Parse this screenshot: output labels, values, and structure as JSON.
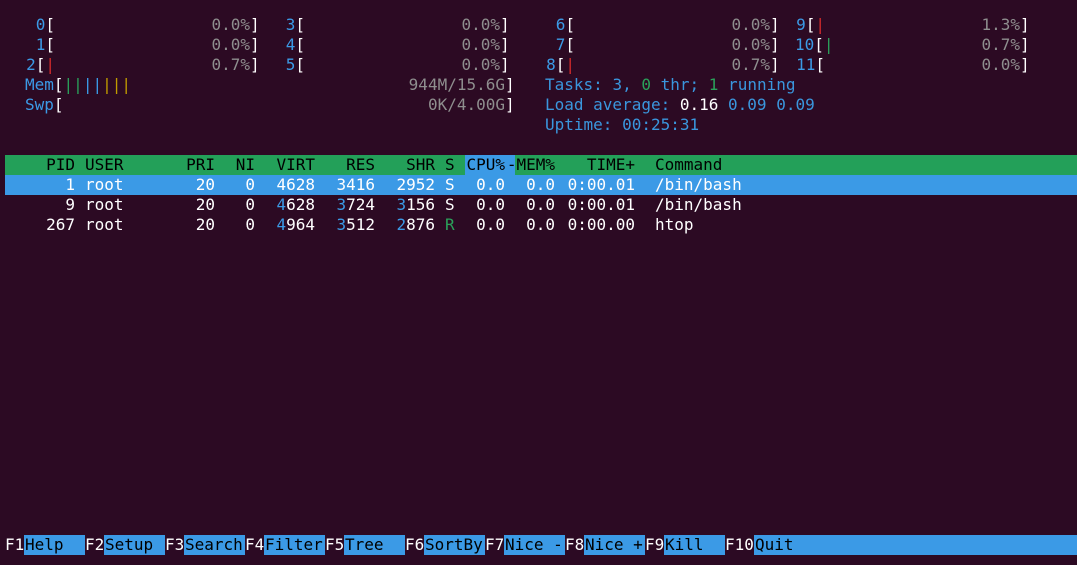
{
  "cpus": [
    {
      "id": "0",
      "pct": "0.0%",
      "bar": ""
    },
    {
      "id": "1",
      "pct": "0.0%",
      "bar": ""
    },
    {
      "id": "2",
      "pct": "0.7%",
      "bar": "|"
    },
    {
      "id": "3",
      "pct": "0.0%",
      "bar": ""
    },
    {
      "id": "4",
      "pct": "0.0%",
      "bar": ""
    },
    {
      "id": "5",
      "pct": "0.0%",
      "bar": ""
    },
    {
      "id": "6",
      "pct": "0.0%",
      "bar": ""
    },
    {
      "id": "7",
      "pct": "0.0%",
      "bar": ""
    },
    {
      "id": "8",
      "pct": "0.7%",
      "bar": "|"
    },
    {
      "id": "9",
      "pct": "1.3%",
      "bar": "|"
    },
    {
      "id": "10",
      "pct": "0.7%",
      "bar": "|"
    },
    {
      "id": "11",
      "pct": "0.0%",
      "bar": ""
    }
  ],
  "mem": {
    "label": "Mem",
    "value": "944M/15.6G"
  },
  "swp": {
    "label": "Swp",
    "value": "0K/4.00G"
  },
  "tasks": {
    "prefix": "Tasks: ",
    "count": "3",
    "sep1": ", ",
    "thr": "0",
    "thr_label": " thr; ",
    "running": "1",
    "running_label": " running"
  },
  "load": {
    "label": "Load average: ",
    "v1": "0.16",
    "v2": "0.09",
    "v3": "0.09"
  },
  "uptime": {
    "label": "Uptime: ",
    "value": "00:25:31"
  },
  "columns": {
    "pid": "PID",
    "user": "USER",
    "pri": "PRI",
    "ni": "NI",
    "virt": "VIRT",
    "res": "RES",
    "shr": "SHR",
    "s": "S",
    "cpu": "CPU%",
    "arrow": "▽",
    "mem": "MEM%",
    "time": "TIME+",
    "command": "Command"
  },
  "processes": [
    {
      "pid": "1",
      "user": "root",
      "pri": "20",
      "ni": "0",
      "virt": "4628",
      "res": "3416",
      "shr": "2952",
      "s": "S",
      "cpu": "0.0",
      "mem": "0.0",
      "time": "0:00.01",
      "command": "/bin/bash"
    },
    {
      "pid": "9",
      "user": "root",
      "pri": "20",
      "ni": "0",
      "virt": "4628",
      "res": "3724",
      "shr": "3156",
      "s": "S",
      "cpu": "0.0",
      "mem": "0.0",
      "time": "0:00.01",
      "command": "/bin/bash"
    },
    {
      "pid": "267",
      "user": "root",
      "pri": "20",
      "ni": "0",
      "virt": "4964",
      "res": "3512",
      "shr": "2876",
      "s": "R",
      "cpu": "0.0",
      "mem": "0.0",
      "time": "0:00.00",
      "command": "htop"
    }
  ],
  "fkeys": [
    {
      "key": "F1",
      "label": "Help  "
    },
    {
      "key": "F2",
      "label": "Setup "
    },
    {
      "key": "F3",
      "label": "Search"
    },
    {
      "key": "F4",
      "label": "Filter"
    },
    {
      "key": "F5",
      "label": "Tree  "
    },
    {
      "key": "F6",
      "label": "SortBy"
    },
    {
      "key": "F7",
      "label": "Nice -"
    },
    {
      "key": "F8",
      "label": "Nice +"
    },
    {
      "key": "F9",
      "label": "Kill  "
    },
    {
      "key": "F10",
      "label": "Quit  "
    }
  ],
  "colors": {
    "bg": "#2c0a23",
    "header_bar": "#23a059",
    "selected": "#3b9ae6",
    "label_blue": "#3b9ae6",
    "green": "#2aa15a",
    "red": "#d52b2b"
  }
}
